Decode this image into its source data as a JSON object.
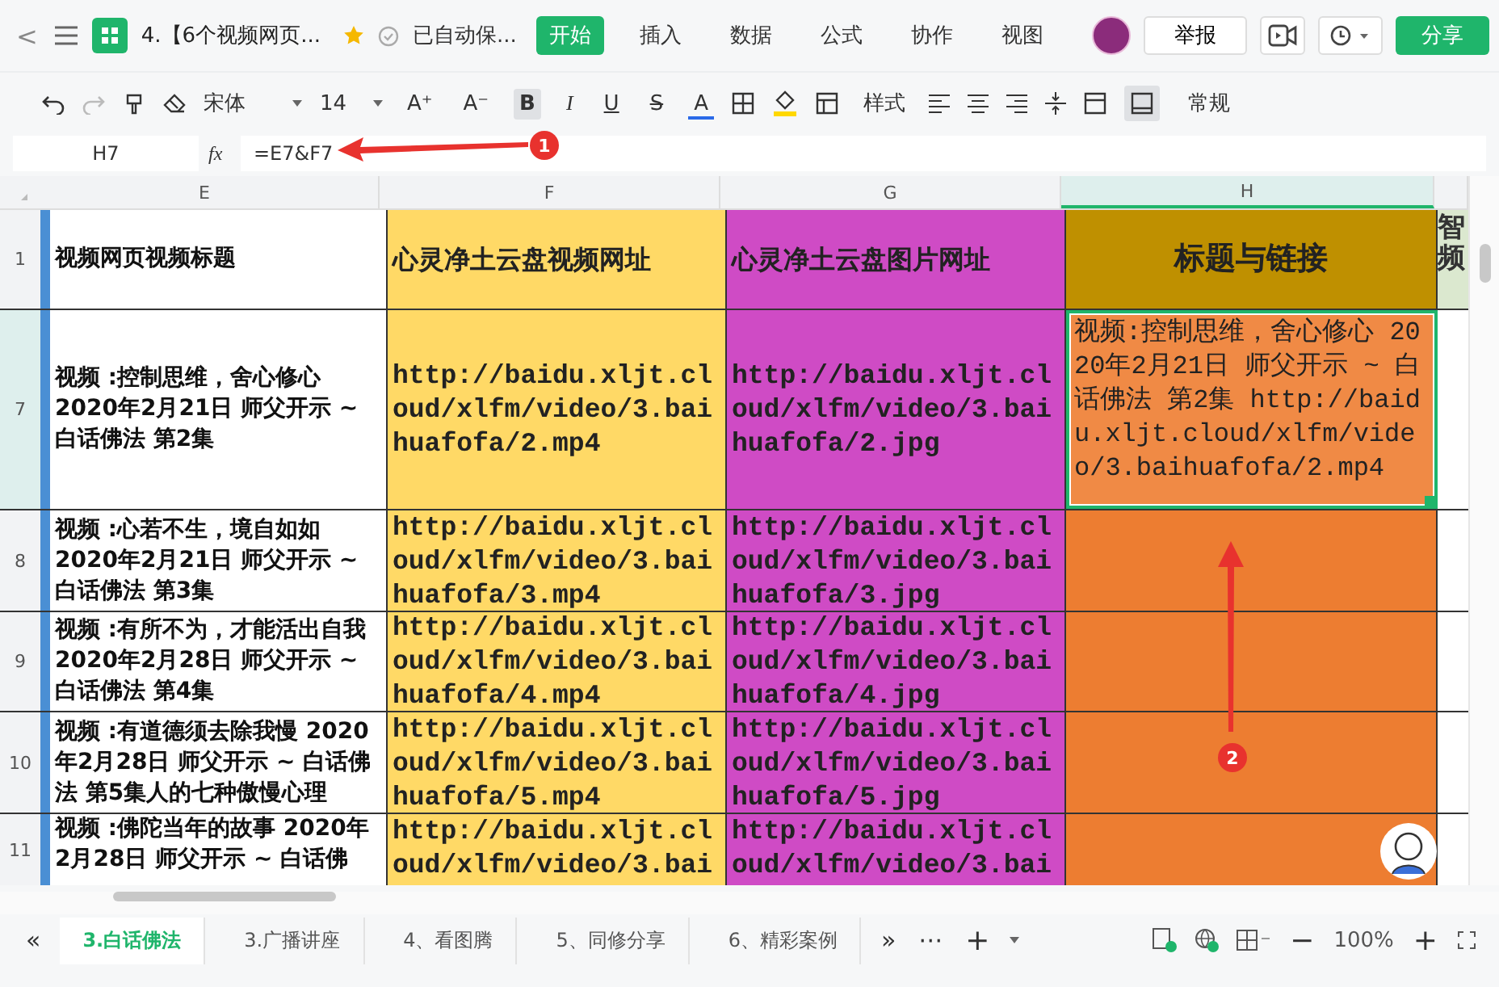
{
  "title_bar": {
    "back": "<",
    "doc_title": "4.【6个视频网页...",
    "save_status": "已自动保...",
    "menu": [
      {
        "label": "开始",
        "selected": true
      },
      {
        "label": "插入",
        "selected": false
      },
      {
        "label": "数据",
        "selected": false
      },
      {
        "label": "公式",
        "selected": false
      },
      {
        "label": "协作",
        "selected": false
      },
      {
        "label": "视图",
        "selected": false
      }
    ],
    "report_button": "举报",
    "share_button": "分享"
  },
  "toolbar": {
    "font": "宋体",
    "size": "14",
    "grow_font": "A⁺",
    "shrink_font": "A⁻",
    "bold": "B",
    "bold_on": true,
    "italic": "I",
    "underline": "U",
    "strike": "S",
    "font_color": "A",
    "style_label": "样式",
    "number_format": "常规"
  },
  "formula_bar": {
    "cell": "H7",
    "fx": "fx",
    "formula": "=E7&F7"
  },
  "columns": [
    {
      "label": "E",
      "selected": false
    },
    {
      "label": "F",
      "selected": false
    },
    {
      "label": "G",
      "selected": false
    },
    {
      "label": "H",
      "selected": true
    }
  ],
  "column_i_header": "智频",
  "rows": [
    {
      "number": "1",
      "selected": false,
      "cells": [
        {
          "text": "视频网页视频标题",
          "selected": false
        },
        {
          "text": "心灵净土云盘视频网址",
          "selected": false
        },
        {
          "text": "心灵净土云盘图片网址",
          "selected": false
        },
        {
          "text": "标题与链接",
          "selected": false
        }
      ]
    },
    {
      "number": "7",
      "selected": true,
      "cells": [
        {
          "text": "视频 :控制思维，舍心修心 2020年2月21日 师父开示 ~ 白话佛法 第2集",
          "selected": false
        },
        {
          "text": "http://baidu.xljt.cloud/xlfm/video/3.baihuafofa/2.mp4",
          "selected": false
        },
        {
          "text": "http://baidu.xljt.cloud/xlfm/video/3.baihuafofa/2.jpg",
          "selected": false
        },
        {
          "text": "视频:控制思维，舍心修心 2020年2月21日 师父开示 ~ 白话佛法 第2集 http://baidu.xljt.cloud/xlfm/video/3.baihuafofa/2.mp4",
          "selected": true
        }
      ]
    },
    {
      "number": "8",
      "selected": false,
      "cells": [
        {
          "text": "视频 :心若不生，境自如如 2020年2月21日 师父开示 ~ 白话佛法 第3集",
          "selected": false
        },
        {
          "text": "http://baidu.xljt.cloud/xlfm/video/3.baihuafofa/3.mp4",
          "selected": false
        },
        {
          "text": "http://baidu.xljt.cloud/xlfm/video/3.baihuafofa/3.jpg",
          "selected": false
        },
        {
          "selected": false
        }
      ]
    },
    {
      "number": "9",
      "selected": false,
      "cells": [
        {
          "text": "视频 :有所不为，才能活出自我 2020年2月28日 师父开示 ~ 白话佛法 第4集",
          "selected": false
        },
        {
          "text": "http://baidu.xljt.cloud/xlfm/video/3.baihuafofa/4.mp4",
          "selected": false
        },
        {
          "text": "http://baidu.xljt.cloud/xlfm/video/3.baihuafofa/4.jpg",
          "selected": false
        },
        {
          "selected": false
        }
      ]
    },
    {
      "number": "10",
      "selected": false,
      "cells": [
        {
          "text": "视频 :有道德须去除我慢 2020年2月28日 师父开示 ~ 白话佛法 第5集人的七种傲慢心理",
          "selected": false
        },
        {
          "text": "http://baidu.xljt.cloud/xlfm/video/3.baihuafofa/5.mp4",
          "selected": false
        },
        {
          "text": "http://baidu.xljt.cloud/xlfm/video/3.baihuafofa/5.jpg",
          "selected": false
        },
        {
          "selected": false
        }
      ]
    },
    {
      "number": "11",
      "selected": false,
      "cells": [
        {
          "text": "视频 :佛陀当年的故事 2020年2月28日 师父开示 ~ 白话佛",
          "selected": false
        },
        {
          "text": "http://baidu.xljt.cloud/xlfm/video/3.bai",
          "selected": false
        },
        {
          "text": "http://baidu.xljt.cloud/xlfm/video/3.bai",
          "selected": false
        },
        {
          "selected": false
        }
      ]
    }
  ],
  "sheet_bar": {
    "prev": "«",
    "next": "»",
    "more": "⋯",
    "add": "+",
    "tabs": [
      {
        "label": "3.白话佛法",
        "selected": true
      },
      {
        "label": "3.广播讲座",
        "selected": false
      },
      {
        "label": "4、看图腾",
        "selected": false
      },
      {
        "label": "5、同修分享",
        "selected": false
      },
      {
        "label": "6、精彩案例",
        "selected": false
      }
    ],
    "zoom_out": "−",
    "zoom": "100%",
    "zoom_in": "+"
  },
  "annotations": [
    {
      "label": "1"
    },
    {
      "label": "2"
    }
  ]
}
